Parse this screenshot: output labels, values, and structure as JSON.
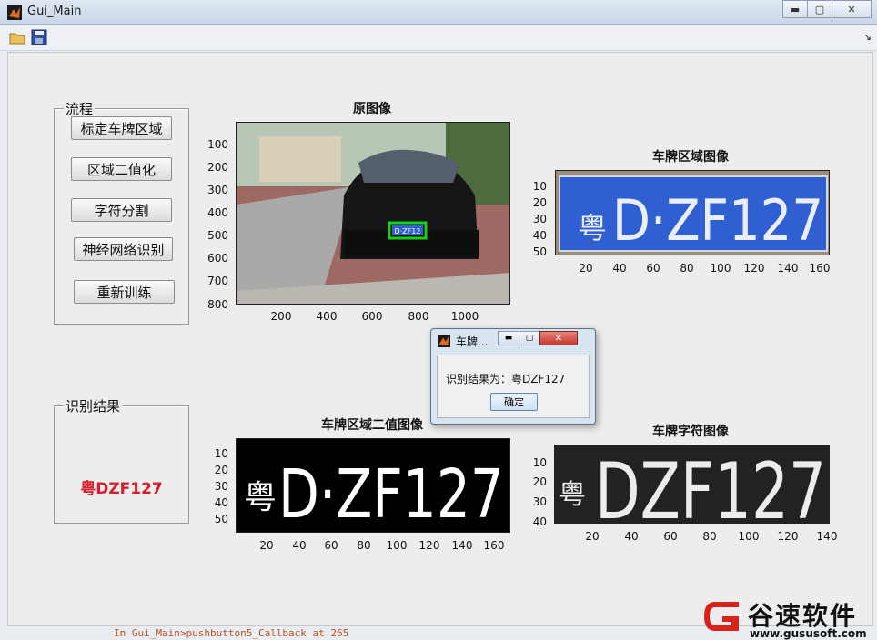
{
  "window": {
    "title": "Gui_Main",
    "buttons": [
      "minimize",
      "maximize",
      "close"
    ]
  },
  "toolbar": {
    "items": [
      {
        "icon": "open-folder-icon"
      },
      {
        "icon": "save-icon"
      }
    ],
    "dock_glyph": "↘"
  },
  "process_panel": {
    "title": "流程",
    "buttons": [
      "标定车牌区域",
      "区域二值化",
      "字符分割",
      "神经网络识别",
      "重新训练"
    ]
  },
  "result_panel": {
    "title": "识别结果",
    "value": "粤DZF127"
  },
  "axes": {
    "original": {
      "title": "原图像",
      "yticks": [
        "100",
        "200",
        "300",
        "400",
        "500",
        "600",
        "700",
        "800"
      ],
      "xticks": [
        "200",
        "400",
        "600",
        "800",
        "1000"
      ],
      "plate_text": "D·ZF12"
    },
    "plate_region": {
      "title": "车牌区域图像",
      "yticks": [
        "10",
        "20",
        "30",
        "40",
        "50"
      ],
      "xticks": [
        "20",
        "40",
        "60",
        "80",
        "100",
        "120",
        "140",
        "160"
      ],
      "plate_text": "D·ZF127",
      "province": "粤"
    },
    "binary": {
      "title": "车牌区域二值图像",
      "yticks": [
        "10",
        "20",
        "30",
        "40",
        "50"
      ],
      "xticks": [
        "20",
        "40",
        "60",
        "80",
        "100",
        "120",
        "140",
        "160"
      ],
      "plate_text": "D·ZF127",
      "province": "粤"
    },
    "chars": {
      "title": "车牌字符图像",
      "yticks": [
        "10",
        "20",
        "30",
        "40"
      ],
      "xticks": [
        "20",
        "40",
        "60",
        "80",
        "100",
        "120",
        "140"
      ],
      "plate_text": "DZF127",
      "province": "粤"
    }
  },
  "dialog": {
    "title": "车牌...",
    "message": "识别结果为：粤DZF127",
    "ok_label": "确定"
  },
  "watermark": {
    "brand": "谷速软件",
    "url": "www.gususoft.com"
  },
  "console_hint": "In Gui_Main>pushbutton5_Callback at 265",
  "colors": {
    "result_red": "#d4202a",
    "plate_blue": "#2f5fd0",
    "detect_green": "#19d019"
  }
}
